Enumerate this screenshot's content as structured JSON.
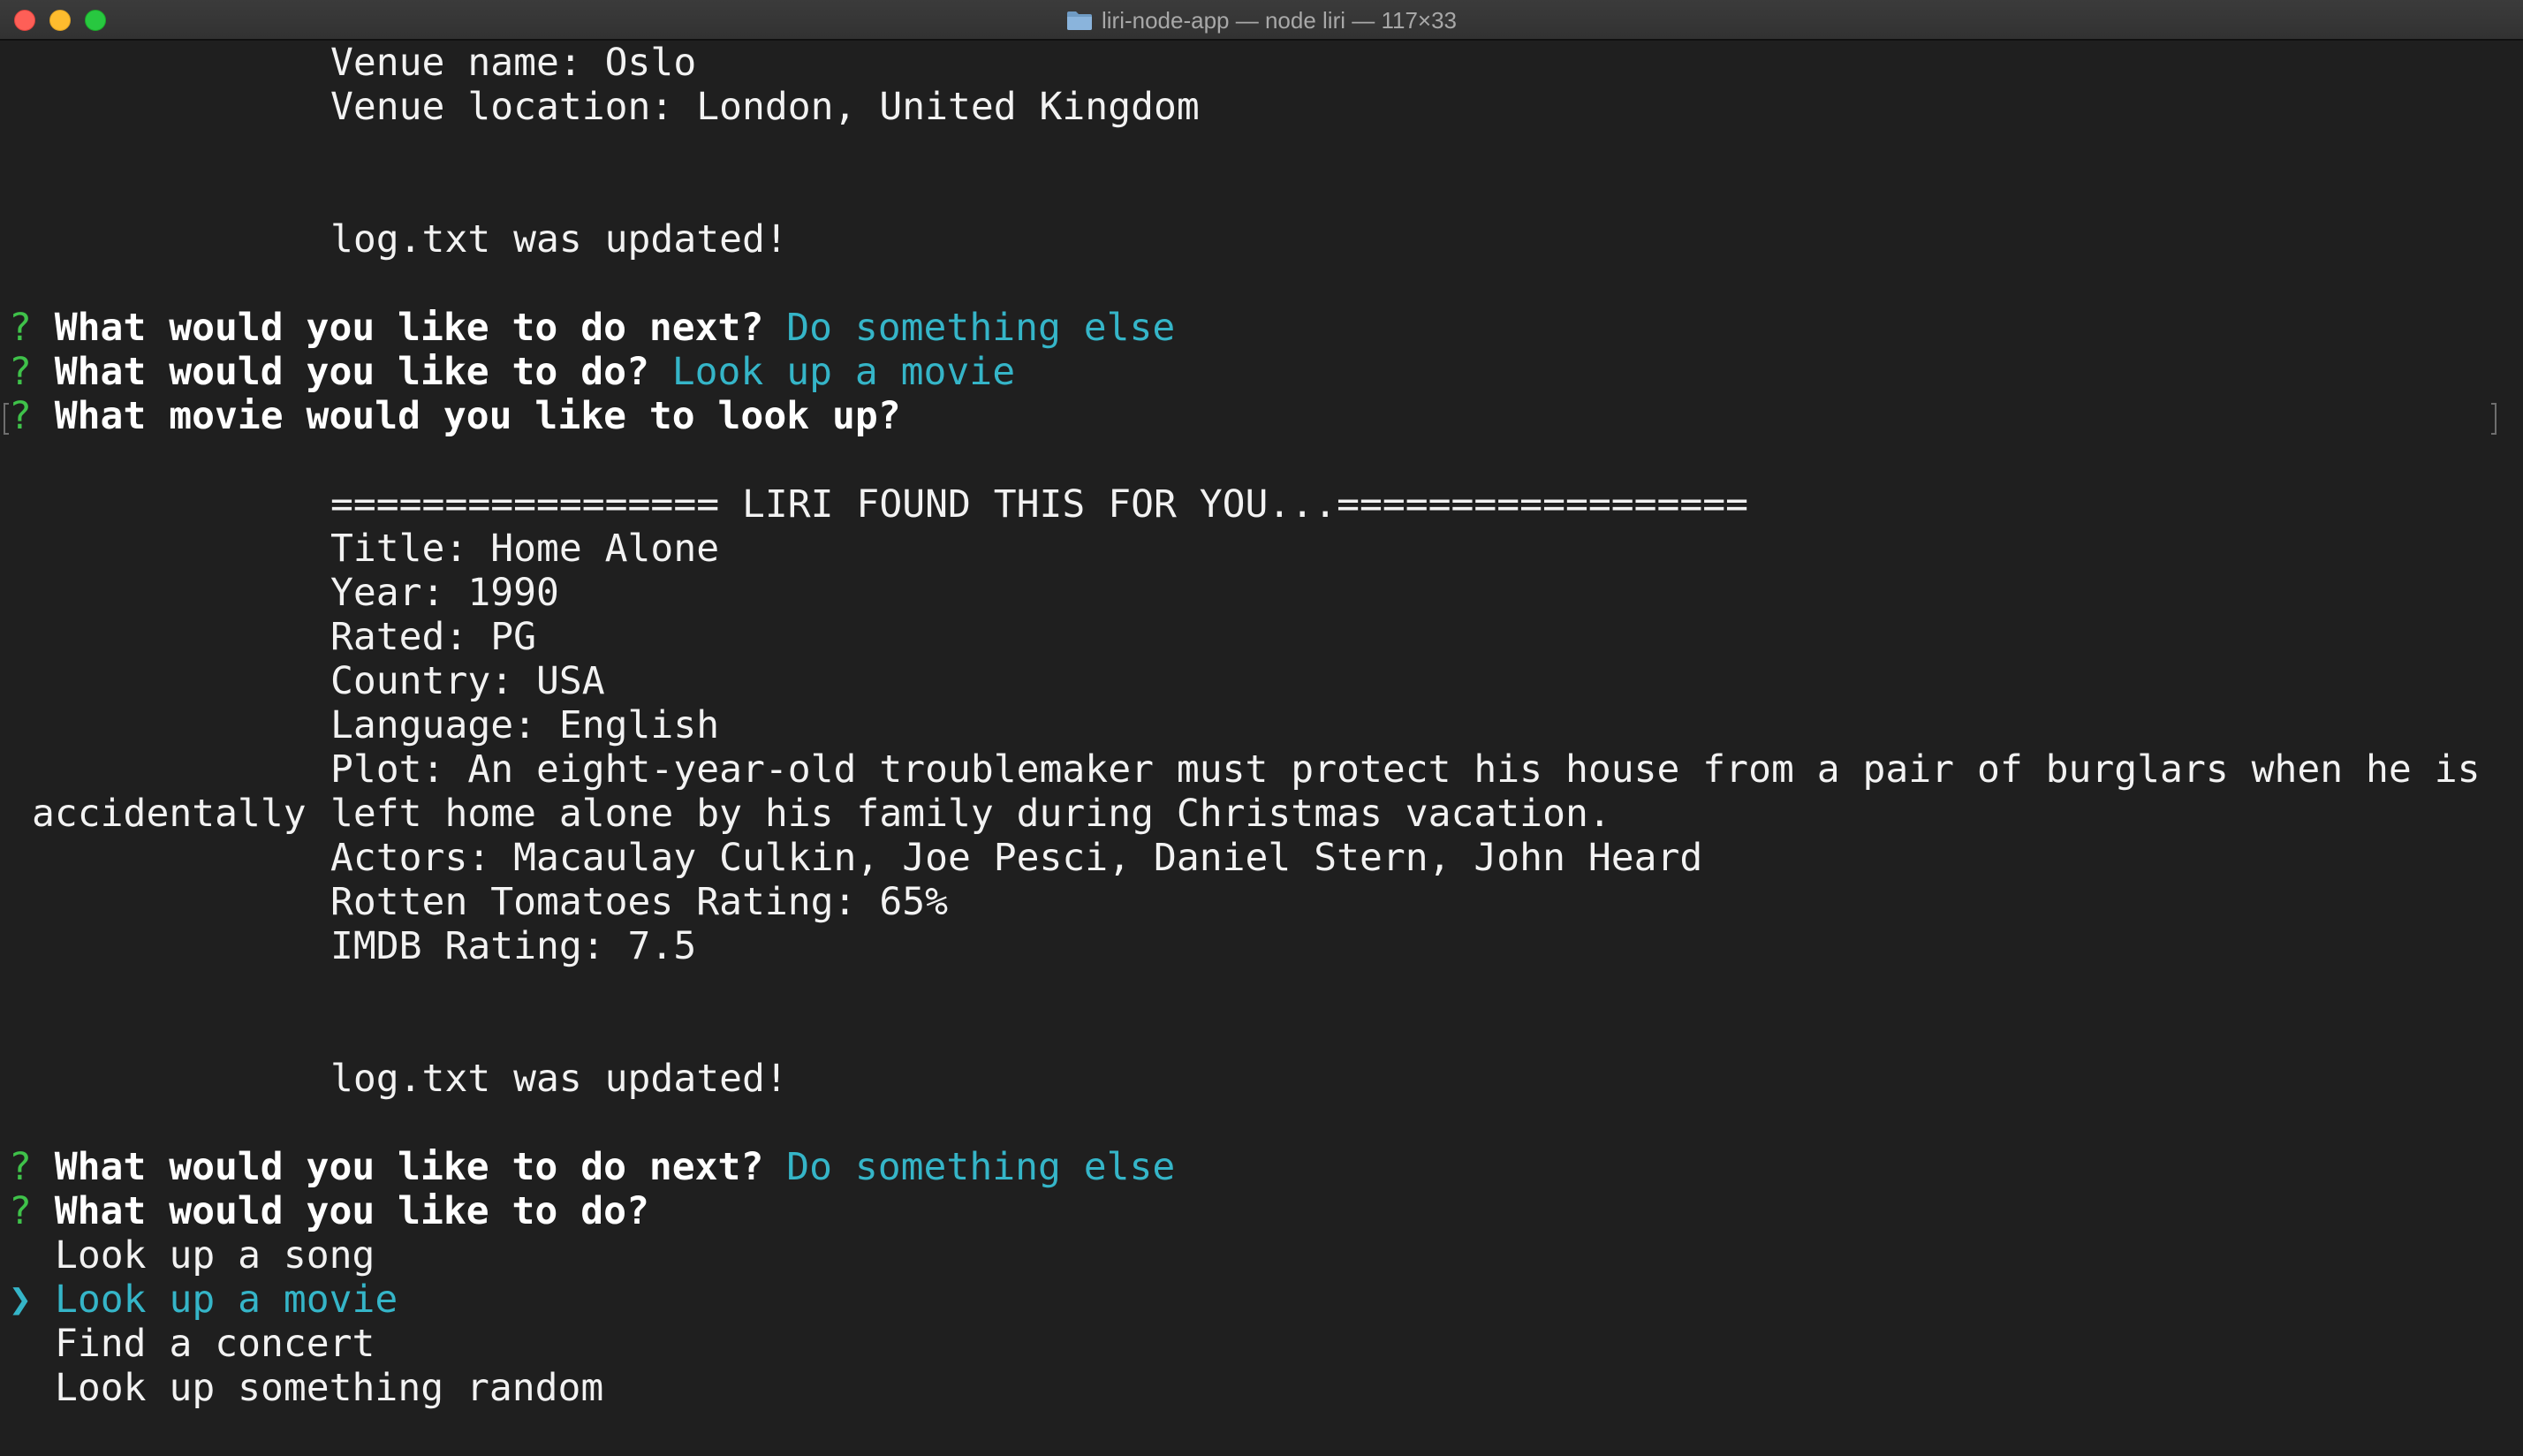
{
  "window": {
    "title": "liri-node-app — node liri — 117×33"
  },
  "terminal": {
    "venue_name": "Venue name: Oslo",
    "venue_location": "Venue location: London, United Kingdom",
    "log_updated_1": "log.txt was updated!",
    "prompt_marker": "?",
    "q_next_1": "What would you like to do next?",
    "a_next_1": "Do something else",
    "q_do_1": "What would you like to do?",
    "a_do_1": "Look up a movie",
    "q_movie": "What movie would you like to look up?",
    "banner": "================= LIRI FOUND THIS FOR YOU...==================",
    "title": "Title: Home Alone",
    "year": "Year: 1990",
    "rated": "Rated: PG",
    "country": "Country: USA",
    "language": "Language: English",
    "plot_1": "Plot: An eight-year-old troublemaker must protect his house from a pair of burglars when he is",
    "plot_2_prefix": "accidentally",
    "plot_2": "left home alone by his family during Christmas vacation.",
    "actors": "Actors: Macaulay Culkin, Joe Pesci, Daniel Stern, John Heard",
    "rotten": "Rotten Tomatoes Rating: 65%",
    "imdb": "IMDB Rating: 7.5",
    "log_updated_2": "log.txt was updated!",
    "q_next_2": "What would you like to do next?",
    "a_next_2": "Do something else",
    "q_do_2": "What would you like to do?",
    "selector_marker": "❯",
    "menu": [
      "Look up a song",
      "Look up a movie",
      "Find a concert",
      "Look up something random"
    ],
    "selected_index": 1
  },
  "colors": {
    "prompt_marker": "#3fc24a",
    "answer": "#35b5c8",
    "background": "#1f1f1f"
  },
  "icons": {
    "title_icon": "folder-icon"
  }
}
